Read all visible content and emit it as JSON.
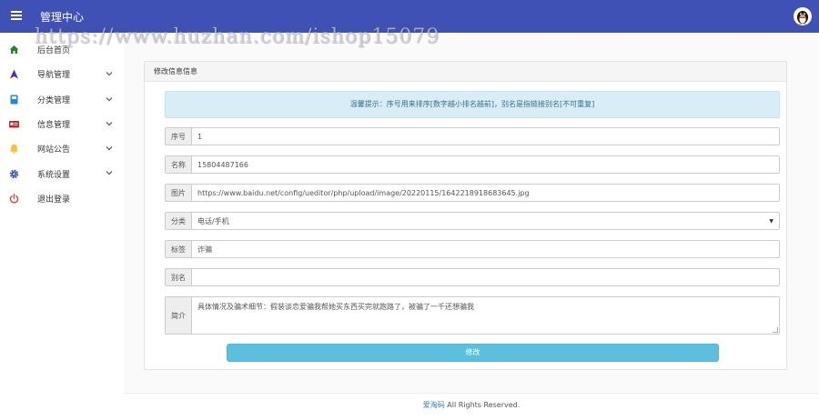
{
  "header": {
    "title": "管理中心"
  },
  "watermark": {
    "text": "https://www.huzhan.com/ishop15079"
  },
  "sidebar": {
    "items": [
      {
        "label": "后台首页",
        "icon": "home-icon",
        "color": "#2e7d32"
      },
      {
        "label": "导航管理",
        "icon": "navigation-arrow-icon",
        "color": "#512da8"
      },
      {
        "label": "分类管理",
        "icon": "book-icon",
        "color": "#1e88e5"
      },
      {
        "label": "信息管理",
        "icon": "id-card-icon",
        "color": "#c62828"
      },
      {
        "label": "网站公告",
        "icon": "bell-icon",
        "color": "#fbc02d"
      },
      {
        "label": "系统设置",
        "icon": "gear-icon",
        "color": "#3f51b5"
      },
      {
        "label": "退出登录",
        "icon": "power-icon",
        "color": "#e53935"
      }
    ]
  },
  "panel": {
    "title": "修改信息信息",
    "alert": "温馨提示：序号用来排序[数字越小排名越前]，别名是指链接别名[不可重复]"
  },
  "form": {
    "fields": [
      {
        "label": "序号",
        "value": "1"
      },
      {
        "label": "名称",
        "value": "15804487166"
      },
      {
        "label": "图片",
        "value": "https://www.baidu.net/config/ueditor/php/upload/image/20220115/1642218918683645.jpg"
      },
      {
        "label": "分类",
        "value": "电话/手机"
      },
      {
        "label": "标签",
        "value": "诈骗"
      },
      {
        "label": "别名",
        "value": ""
      },
      {
        "label": "简介",
        "value": "具体情况及骗术细节：假装谈恋爱骗我帮她买东西买完就跑路了，被骗了一千还想骗我"
      }
    ],
    "submit_label": "修改"
  },
  "footer": {
    "brand": "爱淘码",
    "text": " All Rights Reserved."
  }
}
